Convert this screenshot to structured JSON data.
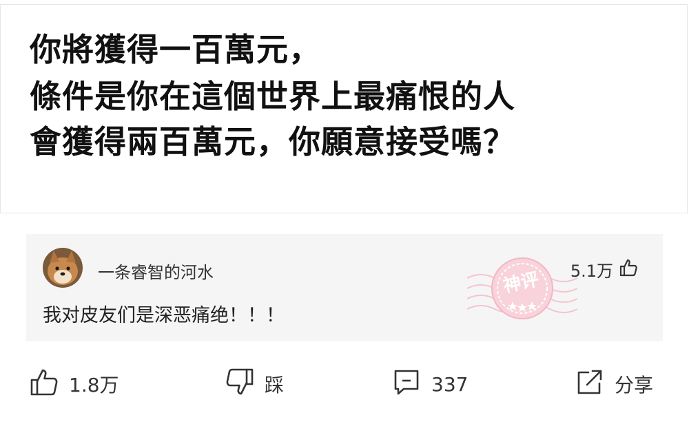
{
  "post": {
    "lines": [
      "你將獲得一百萬元，",
      "條件是你在這個世界上最痛恨的人",
      "會獲得兩百萬元，你願意接受嗎？"
    ]
  },
  "comment": {
    "username": "一条睿智的河水",
    "likes": "5.1万",
    "text": "我对皮友们是深恶痛绝！！！",
    "badge": "神评"
  },
  "actions": {
    "like_count": "1.8万",
    "dislike_label": "踩",
    "comment_count": "337",
    "share_label": "分享"
  },
  "colors": {
    "comment_bg": "#f5f5f5",
    "stamp": "#f4b6c4",
    "icon": "#333333"
  },
  "icons": [
    "avatar-shiba",
    "thumbs-up-icon",
    "thumbs-down-icon",
    "comment-icon",
    "share-icon"
  ]
}
